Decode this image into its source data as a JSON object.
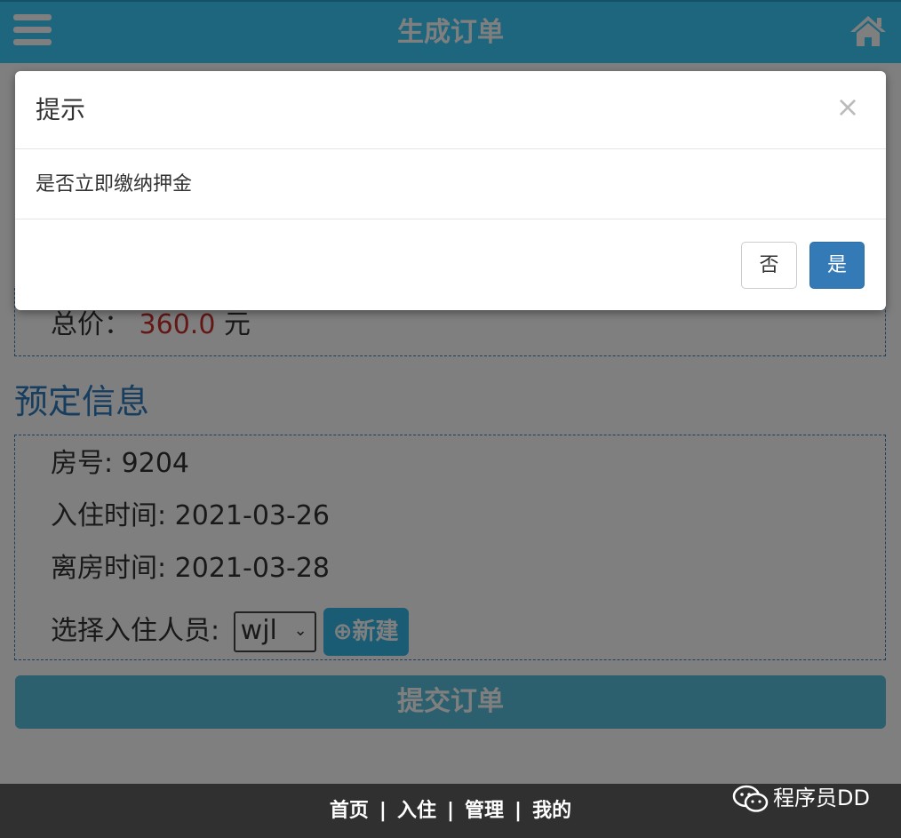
{
  "header": {
    "title": "生成订单",
    "menu_icon": "hamburger-menu-icon",
    "home_icon": "home-icon",
    "color": "#3ccdfc"
  },
  "order": {
    "total_label": "总价：",
    "total_value": "360.0",
    "total_unit": "元"
  },
  "booking": {
    "section_title": "预定信息",
    "room_label": "房号: ",
    "room_value": "9204",
    "checkin_label": "入住时间: ",
    "checkin_value": "2021-03-26",
    "checkout_label": "离房时间: ",
    "checkout_value": "2021-03-28",
    "guest_label": "选择入住人员: ",
    "guest_selected": "wjl",
    "new_button": "新建"
  },
  "submit_label": "提交订单",
  "modal": {
    "title": "提示",
    "close_glyph": "×",
    "message": "是否立即缴纳押金",
    "no_label": "否",
    "yes_label": "是",
    "primary_color": "#337ab7"
  },
  "footer": {
    "links": [
      "首页",
      "入住",
      "管理",
      "我的"
    ],
    "separator": "|"
  },
  "watermark": {
    "text": "程序员DD",
    "icon": "wechat-icon"
  }
}
